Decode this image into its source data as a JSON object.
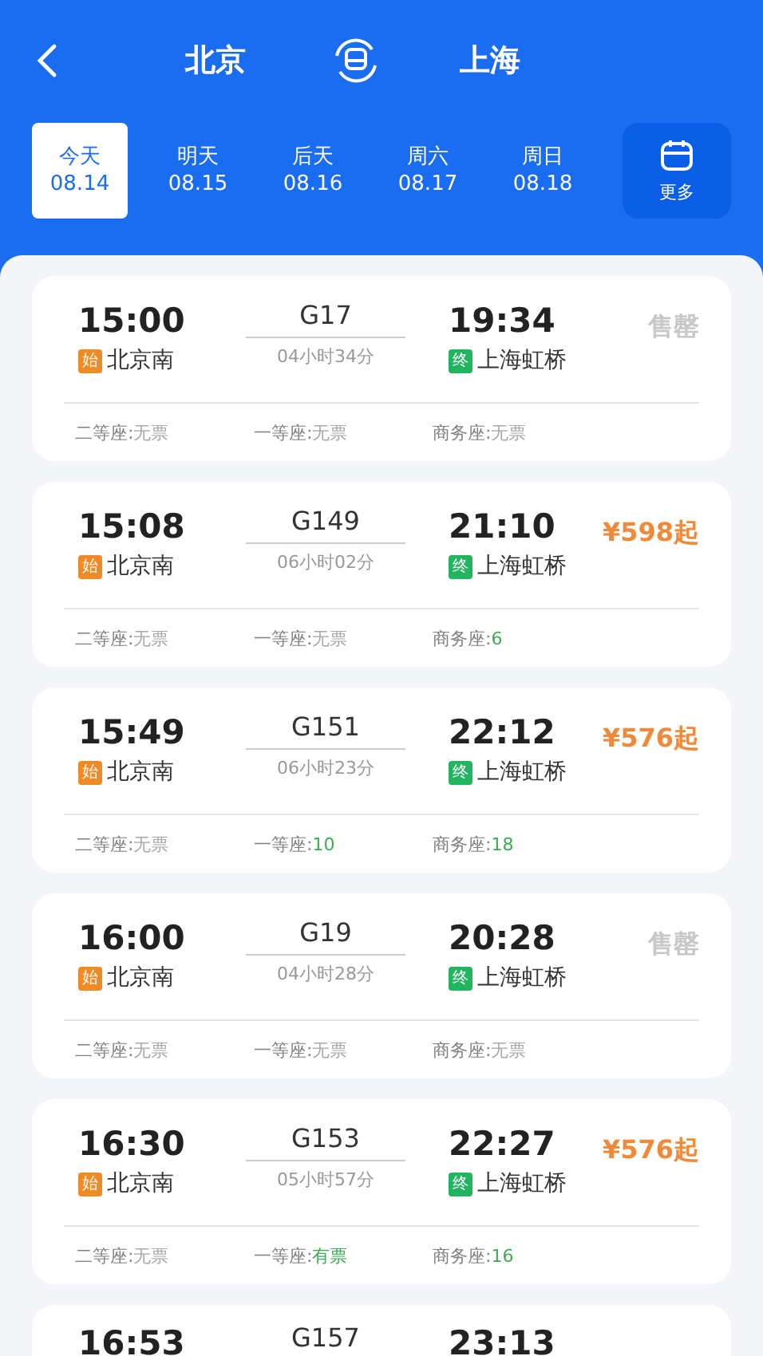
{
  "header": {
    "from": "北京",
    "to": "上海"
  },
  "dates": [
    {
      "day": "今天",
      "date": "08.14",
      "selected": true
    },
    {
      "day": "明天",
      "date": "08.15",
      "selected": false
    },
    {
      "day": "后天",
      "date": "08.16",
      "selected": false
    },
    {
      "day": "周六",
      "date": "08.17",
      "selected": false
    },
    {
      "day": "周日",
      "date": "08.18",
      "selected": false
    }
  ],
  "more_label": "更多",
  "trains": [
    {
      "depart": "15:00",
      "number": "G17",
      "arrive": "19:34",
      "start_tag": "始",
      "from": "北京南",
      "duration": "04小时34分",
      "end_tag": "终",
      "to": "上海虹桥",
      "kind": "soldout",
      "status": "售罄",
      "seats": [
        {
          "label": "二等座:",
          "value": "无票",
          "available": false
        },
        {
          "label": "一等座:",
          "value": "无票",
          "available": false
        },
        {
          "label": "商务座:",
          "value": "无票",
          "available": false
        }
      ]
    },
    {
      "depart": "15:08",
      "number": "G149",
      "arrive": "21:10",
      "start_tag": "始",
      "from": "北京南",
      "duration": "06小时02分",
      "end_tag": "终",
      "to": "上海虹桥",
      "kind": "price",
      "status": "¥598起",
      "seats": [
        {
          "label": "二等座:",
          "value": "无票",
          "available": false
        },
        {
          "label": "一等座:",
          "value": "无票",
          "available": false
        },
        {
          "label": "商务座:",
          "value": "6",
          "available": true
        }
      ]
    },
    {
      "depart": "15:49",
      "number": "G151",
      "arrive": "22:12",
      "start_tag": "始",
      "from": "北京南",
      "duration": "06小时23分",
      "end_tag": "终",
      "to": "上海虹桥",
      "kind": "price",
      "status": "¥576起",
      "seats": [
        {
          "label": "二等座:",
          "value": "无票",
          "available": false
        },
        {
          "label": "一等座:",
          "value": "10",
          "available": true
        },
        {
          "label": "商务座:",
          "value": "18",
          "available": true
        }
      ]
    },
    {
      "depart": "16:00",
      "number": "G19",
      "arrive": "20:28",
      "start_tag": "始",
      "from": "北京南",
      "duration": "04小时28分",
      "end_tag": "终",
      "to": "上海虹桥",
      "kind": "soldout",
      "status": "售罄",
      "seats": [
        {
          "label": "二等座:",
          "value": "无票",
          "available": false
        },
        {
          "label": "一等座:",
          "value": "无票",
          "available": false
        },
        {
          "label": "商务座:",
          "value": "无票",
          "available": false
        }
      ]
    },
    {
      "depart": "16:30",
      "number": "G153",
      "arrive": "22:27",
      "start_tag": "始",
      "from": "北京南",
      "duration": "05小时57分",
      "end_tag": "终",
      "to": "上海虹桥",
      "kind": "price",
      "status": "¥576起",
      "seats": [
        {
          "label": "二等座:",
          "value": "无票",
          "available": false
        },
        {
          "label": "一等座:",
          "value": "有票",
          "available": true
        },
        {
          "label": "商务座:",
          "value": "16",
          "available": true
        }
      ]
    }
  ],
  "partial_train": {
    "depart": "16:53",
    "number": "G157",
    "arrive": "23:13"
  }
}
